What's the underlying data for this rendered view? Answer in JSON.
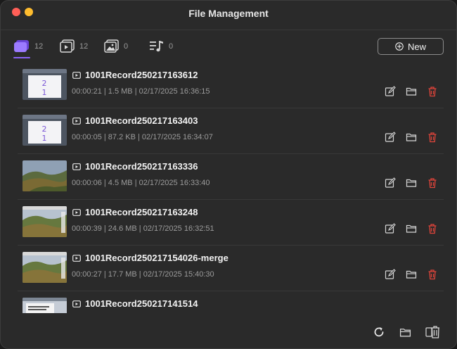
{
  "window": {
    "title": "File Management"
  },
  "tabs": [
    {
      "icon": "video-library-icon",
      "count": "12",
      "active": true
    },
    {
      "icon": "video-play-icon",
      "count": "12",
      "active": false
    },
    {
      "icon": "image-icon",
      "count": "0",
      "active": false
    },
    {
      "icon": "audio-icon",
      "count": "0",
      "active": false
    }
  ],
  "toolbar": {
    "new_label": "New"
  },
  "files": [
    {
      "name": "1001Record250217163612",
      "meta": "00:00:21 | 1.5 MB | 02/17/2025 16:36:15",
      "thumb": "screen"
    },
    {
      "name": "1001Record250217163403",
      "meta": "00:00:05 | 87.2 KB | 02/17/2025 16:34:07",
      "thumb": "screen"
    },
    {
      "name": "1001Record250217163336",
      "meta": "00:00:06 | 4.5 MB | 02/17/2025 16:33:40",
      "thumb": "landscape"
    },
    {
      "name": "1001Record250217163248",
      "meta": "00:00:39 | 24.6 MB | 02/17/2025 16:32:51",
      "thumb": "landscape-ui"
    },
    {
      "name": "1001Record250217154026-merge",
      "meta": "00:00:27 | 17.7 MB | 02/17/2025 15:40:30",
      "thumb": "landscape-ui"
    },
    {
      "name": "1001Record250217141514",
      "meta": "",
      "thumb": "webpage"
    }
  ],
  "colors": {
    "accent": "#8a63f5",
    "delete": "#e0443a",
    "background": "#2a2a2a"
  }
}
